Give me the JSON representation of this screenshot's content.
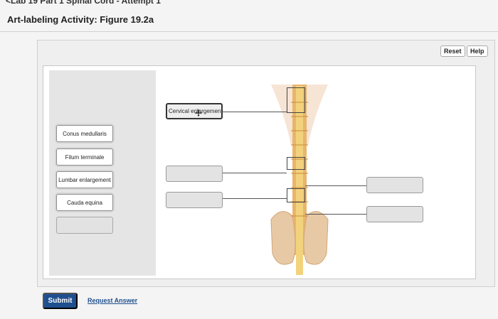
{
  "header": {
    "breadcrumb": "<Lab 19 Part 1 Spinal Cord - Attempt 1",
    "title": "Art-labeling Activity: Figure 19.2a"
  },
  "toolbar": {
    "reset_label": "Reset",
    "help_label": "Help"
  },
  "label_bank": {
    "items": [
      "Conus medullaris",
      "Filum terminale",
      "Lumbar enlargement",
      "Cauda equina",
      ""
    ]
  },
  "targets": {
    "cervical": "Cervical enlargement"
  },
  "footer": {
    "submit_label": "Submit",
    "request_label": "Request Answer"
  },
  "colors": {
    "submit_bg": "#1f4f8f",
    "link": "#1f4f8f",
    "spine": "#e9b56b",
    "cord": "#f2d27c"
  }
}
